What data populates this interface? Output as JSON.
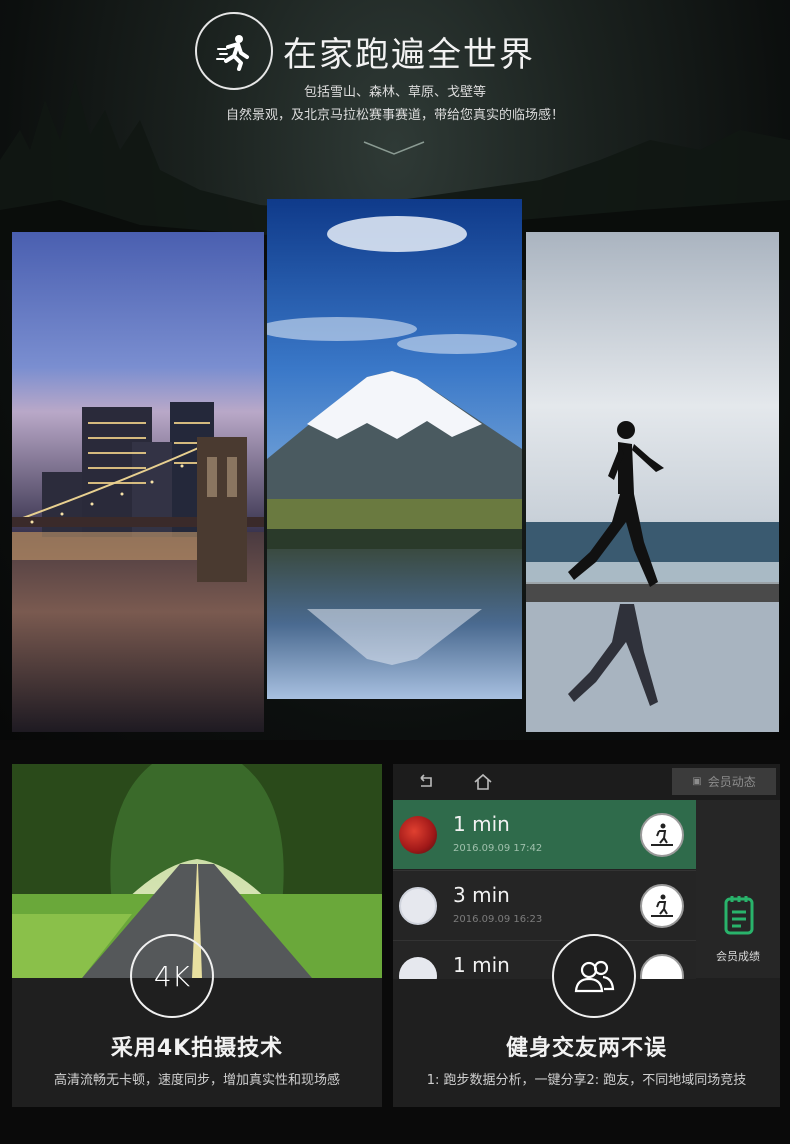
{
  "header": {
    "title": "在家跑遍全世界",
    "line1": "包括雪山、森林、草原、戈壁等",
    "line2": "自然景观，及北京马拉松赛事赛道，带给您真实的临场感！"
  },
  "feature_4k": {
    "badge": "4K",
    "title": "采用4K拍摄技术",
    "desc": "高清流畅无卡顿，速度同步，增加真实性和现场感"
  },
  "feature_social": {
    "title": "健身交友两不误",
    "desc": "1: 跑步数据分析，一键分享2: 跑友，不同地域同场竞技",
    "member_button": "会员动态",
    "side_label": "会员成绩",
    "rows": [
      {
        "minutes": "1 min",
        "date": "2016.09.09  17:42"
      },
      {
        "minutes": "3 min",
        "date": "2016.09.09  16:23"
      },
      {
        "minutes": "1 min",
        "date": ""
      }
    ]
  },
  "colors": {
    "accent_green": "#2f6b4b",
    "icon_green": "#29b36b",
    "card_bg": "#1f1f1f"
  }
}
